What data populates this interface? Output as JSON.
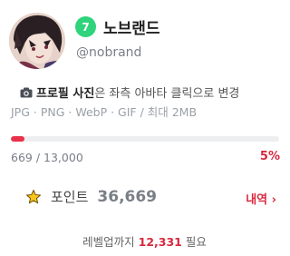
{
  "profile": {
    "level": "7",
    "level_color": "#2fd37c",
    "username": "노브랜드",
    "handle": "@nobrand",
    "avatar_icon": "anime-character-avatar"
  },
  "photo_hint": {
    "icon": "camera-icon",
    "bold": "프로필 사진",
    "rest": "은 좌측 아바타 클릭으로 변경",
    "formats": "JPG · PNG · WebP · GIF / 최대 2MB"
  },
  "experience": {
    "current": "669",
    "total": "13,000",
    "separator": " / ",
    "percent_label": "5%",
    "progress_fraction": 0.05,
    "accent": "#e8324a"
  },
  "points": {
    "icon": "star-icon",
    "label": "포인트",
    "value": "36,669",
    "history_label": "내역 ›"
  },
  "level_up": {
    "prefix": "레벨업까지 ",
    "amount": "12,331",
    "suffix": " 필요"
  }
}
